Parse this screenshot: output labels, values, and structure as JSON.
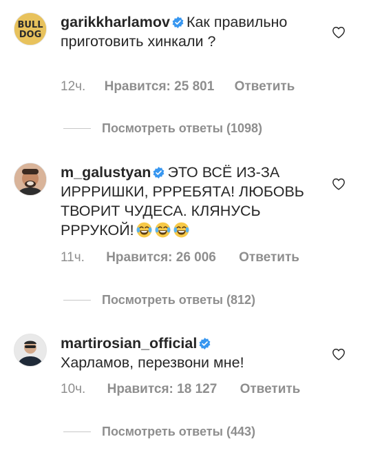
{
  "comments": [
    {
      "username": "garikkharlamov",
      "text": "Как правильно приготовить хинкали ?",
      "emoji_count": 0,
      "time": "12ч.",
      "likes": "Нравится: 25 801",
      "reply": "Ответить",
      "view_replies": "Посмотреть ответы (1098)"
    },
    {
      "username": "m_galustyan",
      "text": "ЭТО ВСЁ ИЗ-ЗА ИРРРИШКИ, РРРЕБЯТА! ЛЮБОВЬ ТВОРИТ ЧУДЕСА. КЛЯНУСЬ РРРУКОЙ!",
      "emoji_count": 3,
      "emoji": "laughing-tears",
      "time": "11ч.",
      "likes": "Нравится: 26 006",
      "reply": "Ответить",
      "view_replies": "Посмотреть ответы (812)"
    },
    {
      "username": "martirosian_official",
      "text": "Харламов, перезвони мне!",
      "emoji_count": 0,
      "time": "10ч.",
      "likes": "Нравится: 18 127",
      "reply": "Ответить",
      "view_replies": "Посмотреть ответы (443)"
    }
  ],
  "avatar1_logo": "BULL DOG",
  "colors": {
    "verified": "#3897f0",
    "meta_text": "#8e8e8e",
    "text": "#262626"
  }
}
